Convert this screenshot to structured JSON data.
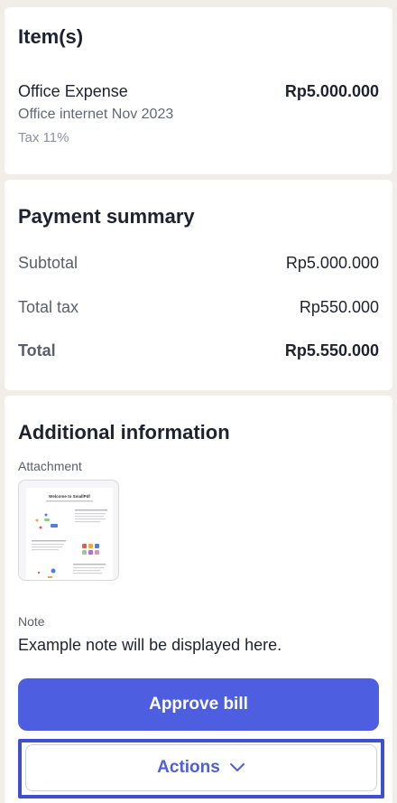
{
  "items_section": {
    "title": "Item(s)",
    "items": [
      {
        "name": "Office Expense",
        "amount": "Rp5.000.000",
        "description": "Office internet Nov 2023",
        "tax": "Tax 11%"
      }
    ]
  },
  "payment_summary": {
    "title": "Payment summary",
    "subtotal_label": "Subtotal",
    "subtotal_value": "Rp5.000.000",
    "total_tax_label": "Total tax",
    "total_tax_value": "Rp550.000",
    "total_label": "Total",
    "total_value": "Rp5.550.000"
  },
  "additional_information": {
    "title": "Additional information",
    "attachment_label": "Attachment",
    "attachment_preview": {
      "heading": "Welcome to SmallPdf"
    },
    "note_label": "Note",
    "note_text": "Example note will be displayed here."
  },
  "actions": {
    "approve_label": "Approve bill",
    "actions_label": "Actions",
    "actions_icon": "chevron-down-icon"
  },
  "colors": {
    "primary": "#4d5ee0",
    "background": "#f1eeea",
    "highlight_border": "#3f4fd0"
  }
}
